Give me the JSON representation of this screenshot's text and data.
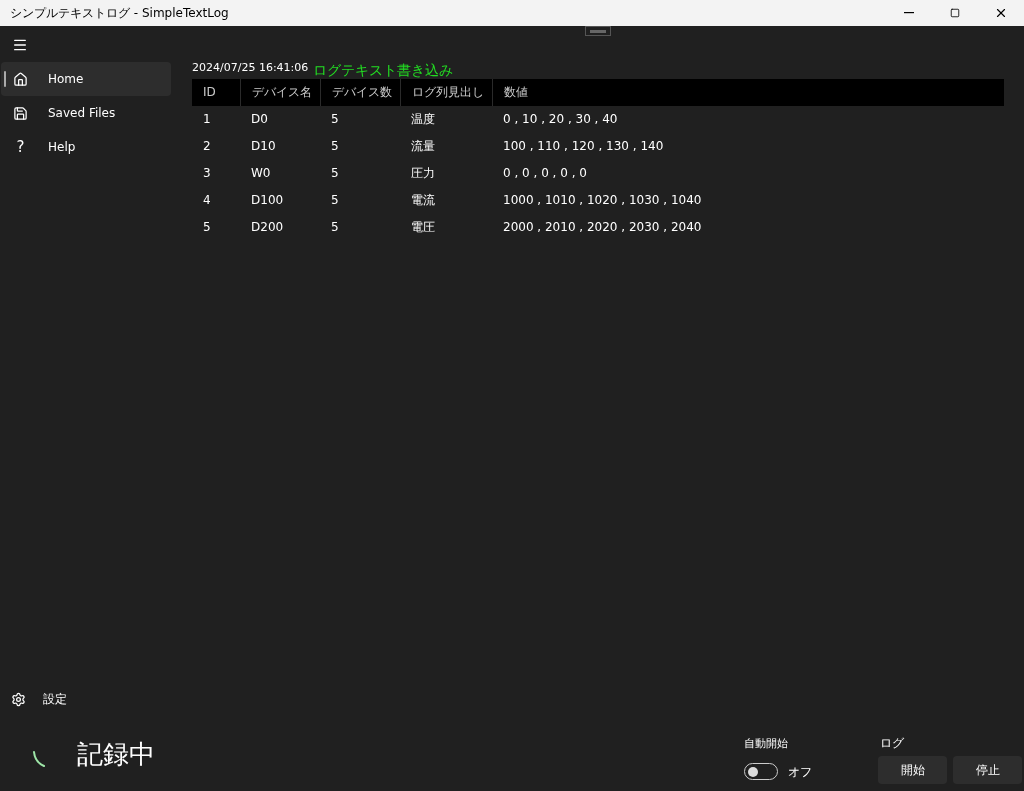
{
  "window": {
    "title": "シンプルテキストログ - SimpleTextLog"
  },
  "sidebar": {
    "items": [
      {
        "label": "Home",
        "kind": "home",
        "selected": true
      },
      {
        "label": "Saved Files",
        "kind": "save",
        "selected": false
      },
      {
        "label": "Help",
        "kind": "glyph",
        "icon": "?",
        "selected": false
      }
    ],
    "settings": {
      "label": "設定"
    }
  },
  "header": {
    "timestamp": "2024/07/25 16:41:06",
    "message": "ログテキスト書き込み"
  },
  "table": {
    "columns": [
      "ID",
      "デバイス名",
      "デバイス数",
      "ログ列見出し",
      "数値"
    ],
    "rows": [
      [
        "1",
        "D0",
        "5",
        "温度",
        "0 , 10 , 20 , 30 , 40"
      ],
      [
        "2",
        "D10",
        "5",
        "流量",
        "100 , 110 , 120 , 130 , 140"
      ],
      [
        "3",
        "W0",
        "5",
        "圧力",
        "0 , 0 , 0 , 0 , 0"
      ],
      [
        "4",
        "D100",
        "5",
        "電流",
        "1000 , 1010 , 1020 , 1030 , 1040"
      ],
      [
        "5",
        "D200",
        "5",
        "電圧",
        "2000 , 2010 , 2020 , 2030 , 2040"
      ]
    ]
  },
  "status": {
    "text": "記録中"
  },
  "auto_start": {
    "label": "自動開始",
    "on": false,
    "state_text": "オフ"
  },
  "log": {
    "label": "ログ",
    "buttons": [
      "開始",
      "停止"
    ]
  }
}
